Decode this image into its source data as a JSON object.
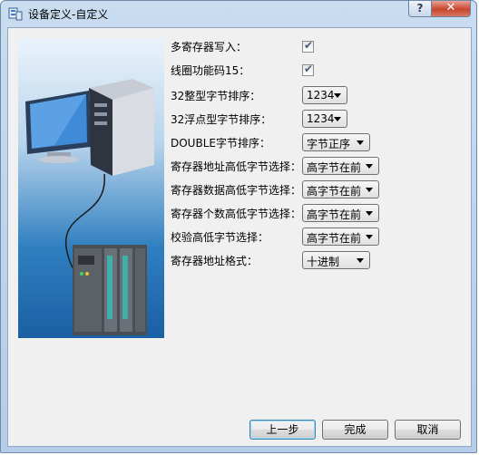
{
  "window": {
    "title": "设备定义-自定义",
    "help_glyph": "?",
    "close_glyph": "✕"
  },
  "settings": {
    "multi_register_write": {
      "label": "多寄存器写入：",
      "checked": true
    },
    "coil_function_15": {
      "label": "线圈功能码15：",
      "checked": true
    },
    "int32_byte_order": {
      "label": "32整型字节排序：",
      "value": "1234"
    },
    "float32_byte_order": {
      "label": "32浮点型字节排序：",
      "value": "1234"
    },
    "double_byte_order": {
      "label": "DOUBLE字节排序：",
      "value": "字节正序"
    },
    "register_address_hilo": {
      "label": "寄存器地址高低字节选择：",
      "value": "高字节在前"
    },
    "register_data_hilo": {
      "label": "寄存器数据高低字节选择：",
      "value": "高字节在前"
    },
    "register_count_hilo": {
      "label": "寄存器个数高低字节选择：",
      "value": "高字节在前"
    },
    "checksum_hilo": {
      "label": "校验高低字节选择：",
      "value": "高字节在前"
    },
    "register_address_format": {
      "label": "寄存器地址格式：",
      "value": "十进制"
    }
  },
  "buttons": {
    "prev": "上一步",
    "finish": "完成",
    "cancel": "取消"
  },
  "icons": {
    "app": "device-definition-icon",
    "banner": "computer-plc-connection-illustration",
    "check": "checkmark-icon"
  },
  "colors": {
    "titlebar": "#c9dcf0",
    "client": "#f0f0f0",
    "close": "#c8452d",
    "banner": "#2f7fc0"
  }
}
